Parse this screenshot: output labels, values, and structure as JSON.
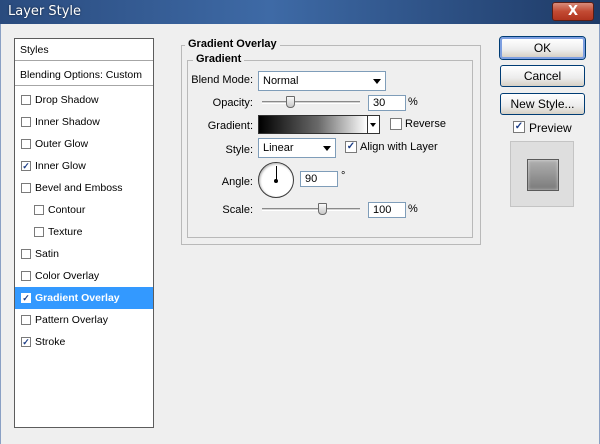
{
  "window": {
    "title": "Layer Style",
    "close_label": "X"
  },
  "styles_list": {
    "header": "Styles",
    "blending": "Blending Options: Custom",
    "items": [
      {
        "label": "Drop Shadow",
        "checked": false,
        "indent": false,
        "selected": false
      },
      {
        "label": "Inner Shadow",
        "checked": false,
        "indent": false,
        "selected": false
      },
      {
        "label": "Outer Glow",
        "checked": false,
        "indent": false,
        "selected": false
      },
      {
        "label": "Inner Glow",
        "checked": true,
        "indent": false,
        "selected": false
      },
      {
        "label": "Bevel and Emboss",
        "checked": false,
        "indent": false,
        "selected": false
      },
      {
        "label": "Contour",
        "checked": false,
        "indent": true,
        "selected": false
      },
      {
        "label": "Texture",
        "checked": false,
        "indent": true,
        "selected": false
      },
      {
        "label": "Satin",
        "checked": false,
        "indent": false,
        "selected": false
      },
      {
        "label": "Color Overlay",
        "checked": false,
        "indent": false,
        "selected": false
      },
      {
        "label": "Gradient Overlay",
        "checked": true,
        "indent": false,
        "selected": true
      },
      {
        "label": "Pattern Overlay",
        "checked": false,
        "indent": false,
        "selected": false
      },
      {
        "label": "Stroke",
        "checked": true,
        "indent": false,
        "selected": false
      }
    ],
    "check_glyph": "✓"
  },
  "gradient_overlay": {
    "section_title": "Gradient Overlay",
    "group_title": "Gradient",
    "blend_mode_label": "Blend Mode:",
    "blend_mode_value": "Normal",
    "opacity_label": "Opacity:",
    "opacity_value": "30",
    "opacity_unit": "%",
    "opacity_level": 30,
    "gradient_label": "Gradient:",
    "reverse_label": "Reverse",
    "reverse_checked": false,
    "style_label": "Style:",
    "style_value": "Linear",
    "align_label": "Align with Layer",
    "align_checked": true,
    "angle_label": "Angle:",
    "angle_value": "90",
    "angle_unit": "°",
    "scale_label": "Scale:",
    "scale_value": "100",
    "scale_unit": "%",
    "scale_level": 100
  },
  "buttons": {
    "ok": "OK",
    "cancel": "Cancel",
    "new_style": "New Style..."
  },
  "preview": {
    "label": "Preview",
    "checked": true
  }
}
